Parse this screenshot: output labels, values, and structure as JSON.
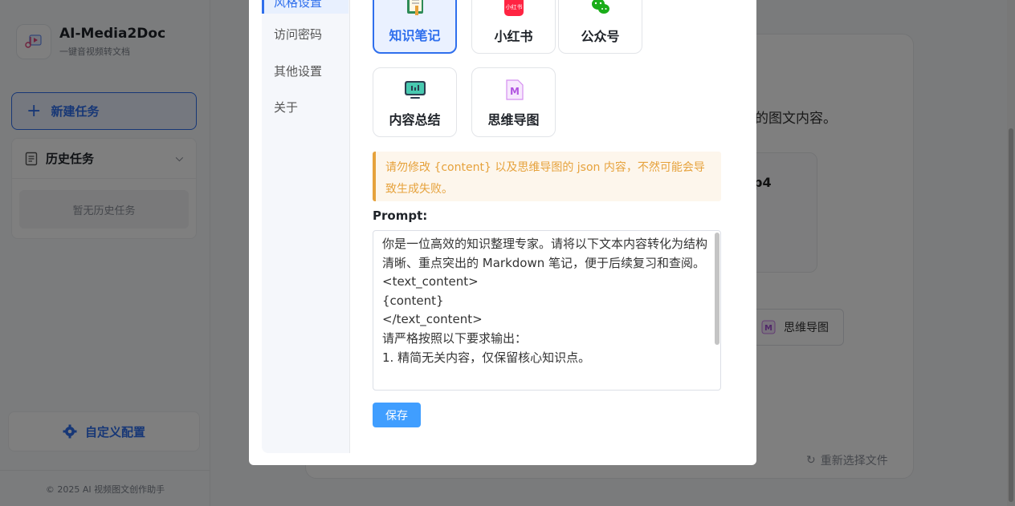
{
  "app": {
    "title": "AI-Media2Doc",
    "subtitle": "一键音视频转文档",
    "new_task": "新建任务",
    "history_title": "历史任务",
    "history_empty": "暂无历史任务",
    "custom_config": "自定义配置",
    "footer": "© 2025 AI 视频图文创作助手"
  },
  "background": {
    "desc_fragment": "的图文内容。",
    "file_fragment": "p4",
    "chip_label": "思维导图",
    "reselect": "重新选择文件"
  },
  "modal": {
    "nav": {
      "active": "风格设置",
      "items": [
        "访问密码",
        "其他设置",
        "关于"
      ]
    },
    "styles": [
      {
        "label": "知识笔记",
        "icon": "notebook-icon",
        "active": true
      },
      {
        "label": "小红书",
        "icon": "xiaohongshu-icon",
        "active": false
      },
      {
        "label": "公众号",
        "icon": "wechat-icon",
        "active": false
      },
      {
        "label": "内容总结",
        "icon": "monitor-icon",
        "active": false
      },
      {
        "label": "思维导图",
        "icon": "mindmap-icon",
        "active": false
      }
    ],
    "xhs_icon_text": "小红书",
    "mindmap_icon_text": "M",
    "warning": "请勿修改 {content} 以及思维导图的 json 内容，不然可能会导致生成失败。",
    "prompt_label": "Prompt:",
    "prompt_text": "你是一位高效的知识整理专家。请将以下文本内容转化为结构清晰、重点突出的 Markdown 笔记，便于后续复习和查阅。\n<text_content>\n{content}\n</text_content>\n请严格按照以下要求输出：\n1. 精简无关内容，仅保留核心知识点。",
    "save": "保存"
  },
  "colors": {
    "primary": "#2f6fed",
    "save_button": "#409eff",
    "warning_text": "#e6a23c",
    "warning_bg": "#fdf6ec"
  }
}
